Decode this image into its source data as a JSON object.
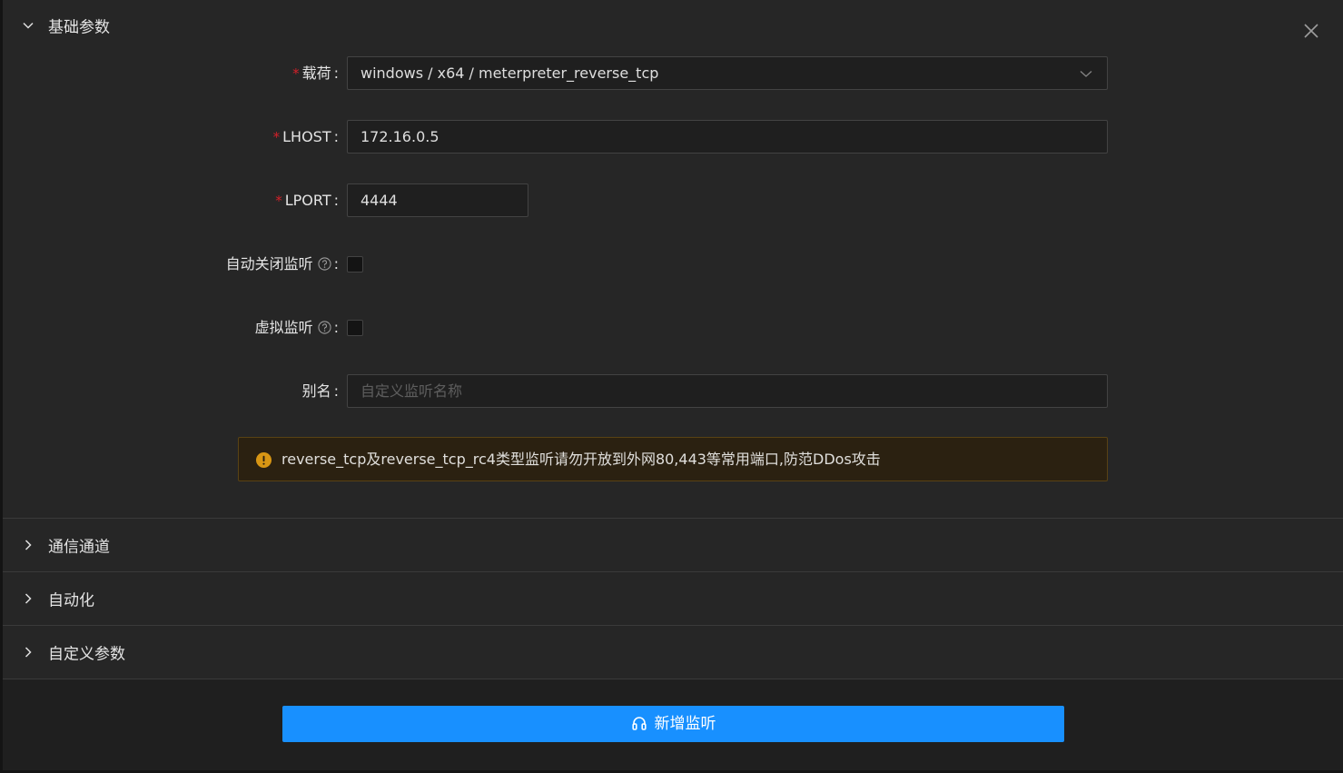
{
  "sections": {
    "basic": {
      "title": "基础参数",
      "expanded": true
    },
    "channel": {
      "title": "通信通道",
      "expanded": false
    },
    "automation": {
      "title": "自动化",
      "expanded": false
    },
    "custom": {
      "title": "自定义参数",
      "expanded": false
    }
  },
  "form": {
    "payload": {
      "label": "载荷",
      "value": "windows / x64 / meterpreter_reverse_tcp",
      "required": true
    },
    "lhost": {
      "label": "LHOST",
      "value": "172.16.0.5",
      "required": true
    },
    "lport": {
      "label": "LPORT",
      "value": "4444",
      "required": true
    },
    "auto_close": {
      "label": "自动关闭监听",
      "checked": false
    },
    "virtual": {
      "label": "虚拟监听",
      "checked": false
    },
    "alias": {
      "label": "别名",
      "value": "",
      "placeholder": "自定义监听名称"
    },
    "colon": ":",
    "required_mark": "*"
  },
  "alert": {
    "message": "reverse_tcp及reverse_tcp_rc4类型监听请勿开放到外网80,443等常用端口,防范DDos攻击",
    "type": "warning"
  },
  "submit": {
    "label": "新增监听"
  },
  "icons": {
    "close": "close-icon",
    "expand": "chevron-down-icon",
    "collapsed": "chevron-right-icon",
    "help": "question-circle-icon",
    "warning": "exclamation-circle-icon",
    "submit": "headphones-icon"
  },
  "colors": {
    "primary": "#1890ff",
    "required": "#d32029",
    "warning": "#d89614",
    "panel_bg": "#262626"
  }
}
